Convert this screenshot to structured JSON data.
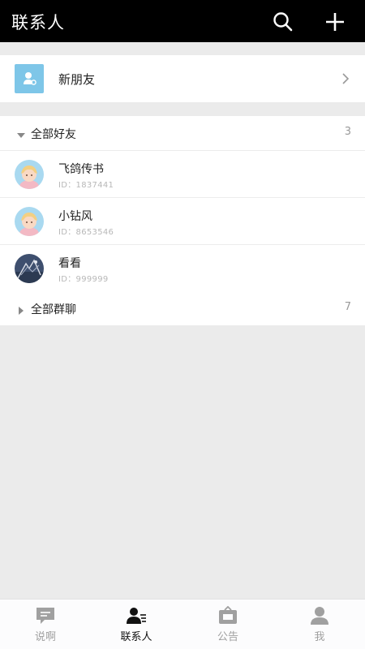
{
  "header": {
    "title": "联系人",
    "search_icon": "search-icon",
    "add_icon": "plus-icon"
  },
  "new_friend": {
    "label": "新朋友",
    "icon": "new-friend-icon",
    "icon_color": "#7ec6e8"
  },
  "groups": [
    {
      "label": "全部好友",
      "count": "3",
      "expanded": true,
      "contacts": [
        {
          "name": "飞鸽传书",
          "id_text": "ID：1837441",
          "avatar": "girl-avatar"
        },
        {
          "name": "小钻风",
          "id_text": "ID：8653546",
          "avatar": "girl-avatar"
        },
        {
          "name": "看看",
          "id_text": "ID：999999",
          "avatar": "photo-avatar"
        }
      ]
    },
    {
      "label": "全部群聊",
      "count": "7",
      "expanded": false,
      "contacts": []
    }
  ],
  "tabbar": {
    "tabs": [
      {
        "label": "说啊",
        "icon": "chat-bubble-icon",
        "active": false
      },
      {
        "label": "联系人",
        "icon": "contacts-icon",
        "active": true
      },
      {
        "label": "公告",
        "icon": "notice-box-icon",
        "active": false
      },
      {
        "label": "我",
        "icon": "person-icon",
        "active": false
      }
    ]
  },
  "colors": {
    "header_bg": "#000000",
    "page_bg": "#ebebeb",
    "active_tab": "#111111",
    "inactive_tab": "#a0a0a0"
  }
}
